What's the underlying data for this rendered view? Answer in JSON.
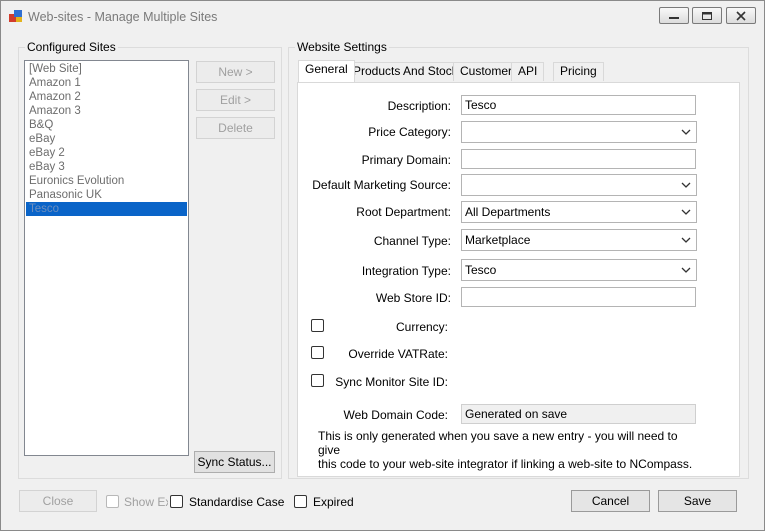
{
  "window": {
    "title": "Web-sites - Manage Multiple Sites"
  },
  "configured_sites": {
    "legend": "Configured Sites",
    "items": [
      "[Web Site]",
      "Amazon 1",
      "Amazon 2",
      "Amazon 3",
      "B&Q",
      "eBay",
      "eBay 2",
      "eBay 3",
      "Euronics Evolution",
      "Panasonic UK",
      "Tesco"
    ],
    "selected": "Tesco",
    "new_label": "New >",
    "edit_label": "Edit >",
    "delete_label": "Delete",
    "sync_status_label": "Sync Status..."
  },
  "footer_left": {
    "close_label": "Close",
    "show_ex_label": "Show Ex",
    "standardise_case_label": "Standardise Case"
  },
  "website_settings": {
    "legend": "Website Settings",
    "tabs": [
      "General",
      "Products And Stock",
      "Customer",
      "API",
      "Pricing"
    ],
    "active_tab": "General",
    "fields": {
      "description": {
        "label": "Description:",
        "value": "Tesco"
      },
      "price_category": {
        "label": "Price Category:",
        "value": ""
      },
      "primary_domain": {
        "label": "Primary Domain:",
        "value": ""
      },
      "default_marketing_source": {
        "label": "Default Marketing Source:",
        "value": ""
      },
      "root_department": {
        "label": "Root Department:",
        "value": "All Departments"
      },
      "channel_type": {
        "label": "Channel Type:",
        "value": "Marketplace"
      },
      "integration_type": {
        "label": "Integration Type:",
        "value": "Tesco"
      },
      "web_store_id": {
        "label": "Web Store ID:",
        "value": ""
      },
      "currency": {
        "label": "Currency:"
      },
      "override_vat_rate": {
        "label": "Override VATRate:"
      },
      "sync_monitor_site_id": {
        "label": "Sync Monitor Site ID:"
      },
      "web_domain_code": {
        "label": "Web Domain Code:",
        "value": "Generated on save"
      }
    },
    "note_line1": "This is only generated when you save a new entry - you will need to give",
    "note_line2": "this code to your web-site integrator if linking a web-site to NCompass."
  },
  "footer_right": {
    "expired_label": "Expired",
    "cancel_label": "Cancel",
    "save_label": "Save"
  },
  "colors": {
    "selection": "#0a64c8",
    "background": "#f0f0f0"
  }
}
